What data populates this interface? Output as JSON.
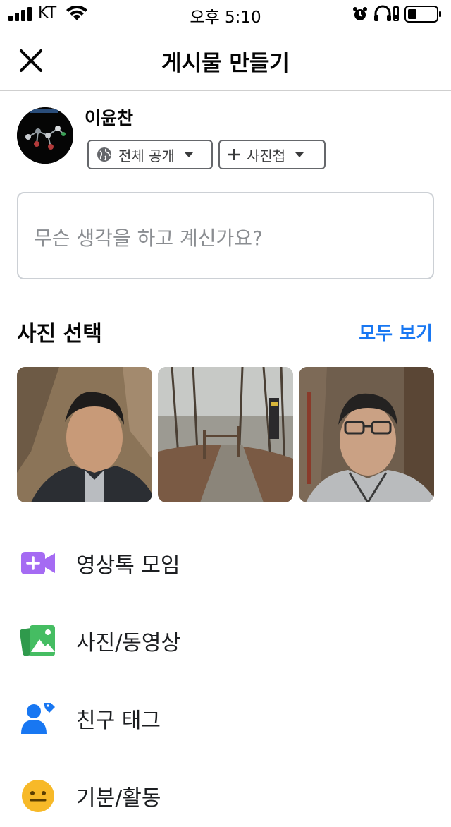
{
  "status_bar": {
    "carrier": "KT",
    "time": "오후 5:10"
  },
  "header": {
    "title": "게시물 만들기"
  },
  "profile": {
    "name": "이윤찬"
  },
  "audience_chips": [
    {
      "label": "전체 공개"
    },
    {
      "label": "사진첩"
    }
  ],
  "composer": {
    "placeholder": "무슨 생각을 하고 계신가요?"
  },
  "photos": {
    "section_title": "사진 선택",
    "see_all": "모두 보기"
  },
  "options": [
    {
      "label": "영상톡 모임",
      "icon": "video-plus-icon",
      "color": "#a56bf3"
    },
    {
      "label": "사진/동영상",
      "icon": "photo-icon",
      "color": "#45bd62"
    },
    {
      "label": "친구 태그",
      "icon": "tag-friend-icon",
      "color": "#1877f2"
    },
    {
      "label": "기분/활동",
      "icon": "smiley-icon",
      "color": "#f7b928"
    }
  ],
  "colors": {
    "accent": "#1877f2",
    "divider": "#cfcfcf"
  }
}
